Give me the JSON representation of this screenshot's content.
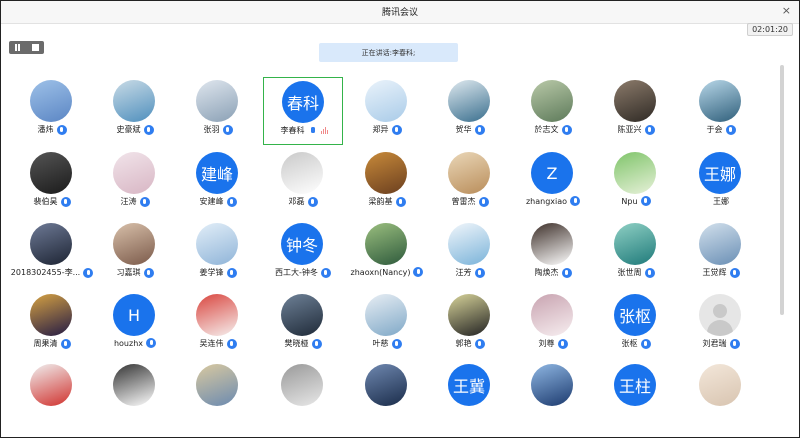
{
  "window": {
    "title": "腾讯会议",
    "timer": "02:01:20",
    "close_glyph": "×"
  },
  "speaking": {
    "prefix": "正在讲话: ",
    "speaker": "李春科;"
  },
  "participants": [
    {
      "name": "潘炜",
      "avatar_text": "",
      "kind": "photo",
      "colors": [
        "#5b86c4",
        "#9ec1e8"
      ]
    },
    {
      "name": "史豪斌",
      "avatar_text": "",
      "kind": "photo",
      "colors": [
        "#4f8fbd",
        "#c9dbe6"
      ]
    },
    {
      "name": "张羽",
      "avatar_text": "",
      "kind": "photo",
      "colors": [
        "#8aa0b5",
        "#dfe6ee"
      ]
    },
    {
      "name": "李春科",
      "avatar_text": "春科",
      "kind": "text",
      "colors": [
        "#1a73ec",
        "#1a73ec"
      ],
      "speaking": true
    },
    {
      "name": "郑异",
      "avatar_text": "",
      "kind": "photo",
      "colors": [
        "#a9cbe8",
        "#eaf3fb"
      ]
    },
    {
      "name": "贺华",
      "avatar_text": "",
      "kind": "photo",
      "colors": [
        "#3a6f8e",
        "#dfe9ef"
      ]
    },
    {
      "name": "於志文",
      "avatar_text": "",
      "kind": "photo",
      "colors": [
        "#5d7a5a",
        "#b9c9a8"
      ]
    },
    {
      "name": "陈亚兴",
      "avatar_text": "",
      "kind": "photo",
      "colors": [
        "#2f2a25",
        "#8c7b6b"
      ]
    },
    {
      "name": "于会",
      "avatar_text": "",
      "kind": "photo",
      "colors": [
        "#2f5f7b",
        "#b8d7e8"
      ]
    },
    {
      "name": "裴伯昊",
      "avatar_text": "",
      "kind": "photo",
      "colors": [
        "#1b1b1b",
        "#555"
      ]
    },
    {
      "name": "汪涛",
      "avatar_text": "",
      "kind": "photo",
      "colors": [
        "#d8b6c4",
        "#f1e4ea"
      ]
    },
    {
      "name": "安建峰",
      "avatar_text": "建峰",
      "kind": "text",
      "colors": [
        "#1a73ec",
        "#1a73ec"
      ]
    },
    {
      "name": "邓磊",
      "avatar_text": "",
      "kind": "photo",
      "colors": [
        "#ffffff",
        "#c9c9c9"
      ]
    },
    {
      "name": "梁韵基",
      "avatar_text": "",
      "kind": "photo",
      "colors": [
        "#6b3f1f",
        "#c88a3a"
      ]
    },
    {
      "name": "曾雷杰",
      "avatar_text": "",
      "kind": "photo",
      "colors": [
        "#b98d5a",
        "#ead7b8"
      ]
    },
    {
      "name": "zhangxiao",
      "avatar_text": "Z",
      "kind": "text",
      "colors": [
        "#1a73ec",
        "#1a73ec"
      ]
    },
    {
      "name": "Npu",
      "avatar_text": "",
      "kind": "photo",
      "colors": [
        "#e7f1d9",
        "#7fc46a"
      ]
    },
    {
      "name": "王娜",
      "avatar_text": "王娜",
      "kind": "text",
      "colors": [
        "#1a73ec",
        "#1a73ec"
      ],
      "mic": "none"
    },
    {
      "name": "2018302455-李...",
      "avatar_text": "",
      "kind": "photo",
      "colors": [
        "#1d2433",
        "#6e7a96"
      ]
    },
    {
      "name": "习嘉琪",
      "avatar_text": "",
      "kind": "photo",
      "colors": [
        "#7b5a4a",
        "#d8c0aa"
      ]
    },
    {
      "name": "姜学锋",
      "avatar_text": "",
      "kind": "photo",
      "colors": [
        "#8fb4d8",
        "#e2eef8"
      ]
    },
    {
      "name": "西工大-钟冬",
      "avatar_text": "钟冬",
      "kind": "text",
      "colors": [
        "#1a73ec",
        "#1a73ec"
      ]
    },
    {
      "name": "zhaoxn(Nancy)",
      "avatar_text": "",
      "kind": "photo",
      "colors": [
        "#2e5a3c",
        "#9bbf7f"
      ]
    },
    {
      "name": "汪芳",
      "avatar_text": "",
      "kind": "photo",
      "colors": [
        "#7ab3d9",
        "#f1f6fb"
      ]
    },
    {
      "name": "陶焕杰",
      "avatar_text": "",
      "kind": "photo",
      "colors": [
        "#ffffff",
        "#3d2f29"
      ]
    },
    {
      "name": "张世周",
      "avatar_text": "",
      "kind": "photo",
      "colors": [
        "#1f7a7a",
        "#8fd0c4"
      ]
    },
    {
      "name": "王觉辉",
      "avatar_text": "",
      "kind": "photo",
      "colors": [
        "#6a8fb5",
        "#d2e0ec"
      ]
    },
    {
      "name": "周果清",
      "avatar_text": "",
      "kind": "photo",
      "colors": [
        "#231a44",
        "#d6a243"
      ]
    },
    {
      "name": "houzhx",
      "avatar_text": "H",
      "kind": "text",
      "colors": [
        "#1a73ec",
        "#1a73ec"
      ]
    },
    {
      "name": "吴连伟",
      "avatar_text": "",
      "kind": "photo",
      "colors": [
        "#f6f0ef",
        "#d9463f"
      ]
    },
    {
      "name": "樊晓桠",
      "avatar_text": "",
      "kind": "photo",
      "colors": [
        "#1f2a38",
        "#6e8197"
      ]
    },
    {
      "name": "叶慈",
      "avatar_text": "",
      "kind": "photo",
      "colors": [
        "#7fa8c7",
        "#e8eef4"
      ]
    },
    {
      "name": "郭艳",
      "avatar_text": "",
      "kind": "photo",
      "colors": [
        "#222",
        "#d8d49a"
      ]
    },
    {
      "name": "刘尊",
      "avatar_text": "",
      "kind": "photo",
      "colors": [
        "#f7eef0",
        "#c8a3b0"
      ]
    },
    {
      "name": "张枢",
      "avatar_text": "张枢",
      "kind": "text",
      "colors": [
        "#1a73ec",
        "#1a73ec"
      ]
    },
    {
      "name": "刘君瑞",
      "avatar_text": "",
      "kind": "grey",
      "colors": [
        "#e6e6e6",
        "#c9c9c9"
      ]
    },
    {
      "name": "",
      "avatar_text": "",
      "kind": "photo",
      "colors": [
        "#d0312d",
        "#f0f0f0"
      ]
    },
    {
      "name": "",
      "avatar_text": "",
      "kind": "photo",
      "colors": [
        "#ffffff",
        "#333"
      ]
    },
    {
      "name": "",
      "avatar_text": "",
      "kind": "photo",
      "colors": [
        "#6b8ab0",
        "#d9c9a0"
      ]
    },
    {
      "name": "",
      "avatar_text": "",
      "kind": "photo",
      "colors": [
        "#e8e8e8",
        "#999"
      ]
    },
    {
      "name": "",
      "avatar_text": "",
      "kind": "photo",
      "colors": [
        "#1a2c4a",
        "#6f88b0"
      ]
    },
    {
      "name": "",
      "avatar_text": "王冀",
      "kind": "text",
      "colors": [
        "#1a73ec",
        "#1a73ec"
      ]
    },
    {
      "name": "",
      "avatar_text": "",
      "kind": "photo",
      "colors": [
        "#1c3a6e",
        "#8fb7e3"
      ]
    },
    {
      "name": "",
      "avatar_text": "王柱",
      "kind": "text",
      "colors": [
        "#1a73ec",
        "#1a73ec"
      ]
    },
    {
      "name": "",
      "avatar_text": "",
      "kind": "photo",
      "colors": [
        "#d8c4b0",
        "#f3e7da"
      ]
    }
  ]
}
